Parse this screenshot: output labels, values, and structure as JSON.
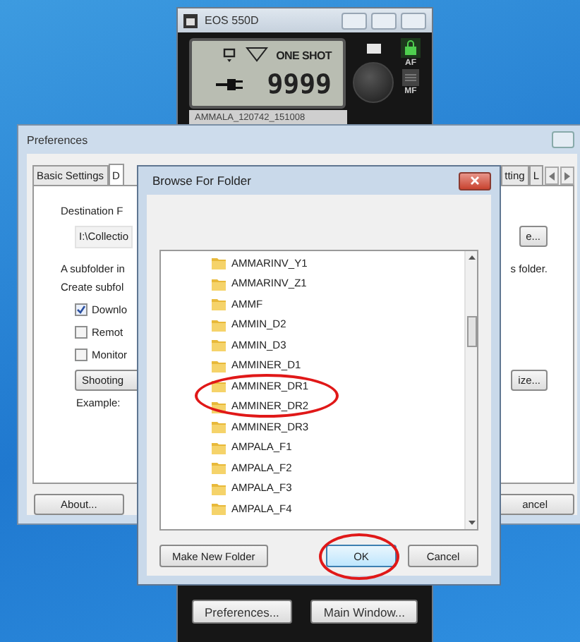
{
  "camera_window": {
    "title": "EOS 550D",
    "lcd": {
      "mode": "ONE SHOT",
      "shots": "9999"
    },
    "af_label": "AF",
    "mf_label": "MF",
    "file_name": "AMMALA_120742_151008",
    "buttons": [
      "Preferences...",
      "Main Window..."
    ]
  },
  "preferences": {
    "title": "Preferences",
    "tabs": [
      {
        "label": "Basic Settings",
        "selected": false
      },
      {
        "label": "D",
        "selected": true
      },
      {
        "label": "tting",
        "selected": false
      },
      {
        "label": "L",
        "selected": false
      }
    ],
    "destination_label": "Destination F",
    "destination_value": "I:\\Collectio",
    "browse_button": "e...",
    "subfolder_text": "A subfolder in",
    "subfolder_text_end": "s folder.",
    "create_label": "Create subfol",
    "options": [
      {
        "label": "Downlo",
        "checked": true
      },
      {
        "label": "Remot",
        "checked": false
      },
      {
        "label": "Monitor",
        "checked": false
      }
    ],
    "shooting_button": "Shooting",
    "settings_button": "ize...",
    "example_label": "Example:",
    "buttons": [
      "About...",
      "ancel"
    ]
  },
  "browse_dialog": {
    "title": "Browse For Folder",
    "folders": [
      "AMMARINV_Y1",
      "AMMARINV_Z1",
      "AMMF",
      "AMMIN_D2",
      "AMMIN_D3",
      "AMMINER_D1",
      "AMMINER_DR1",
      "AMMINER_DR2",
      "AMMINER_DR3",
      "AMPALA_F1",
      "AMPALA_F2",
      "AMPALA_F3",
      "AMPALA_F4"
    ],
    "buttons": [
      {
        "label": "Make New Folder",
        "kind": "normal"
      },
      {
        "label": "OK",
        "kind": "default"
      },
      {
        "label": "Cancel",
        "kind": "normal"
      }
    ]
  }
}
